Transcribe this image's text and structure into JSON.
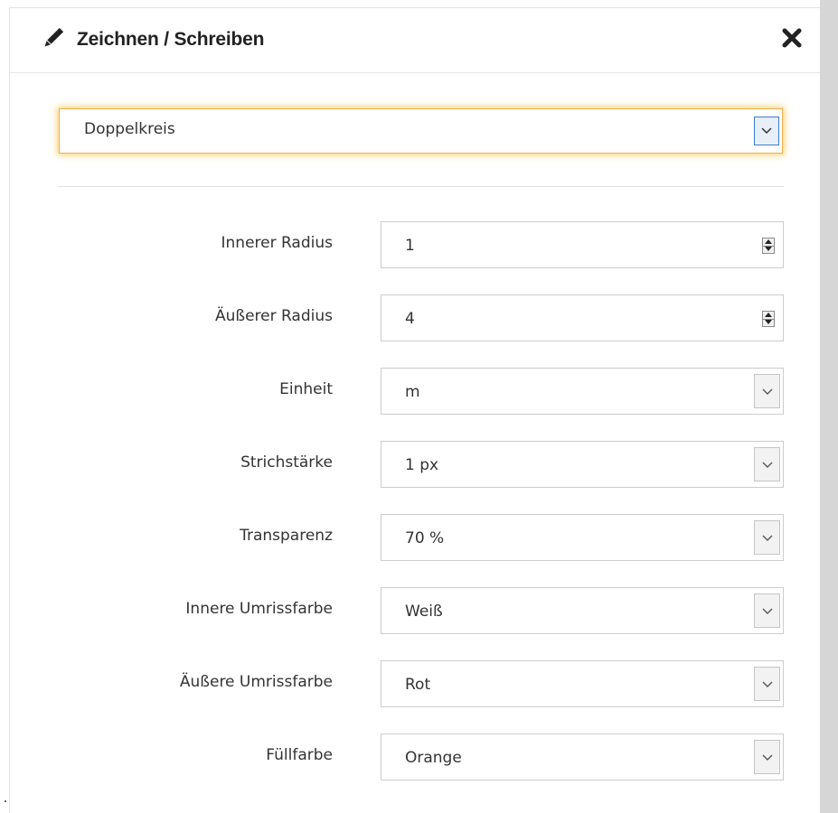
{
  "dialog": {
    "title": "Zeichnen / Schreiben",
    "title_icon": "pencil-icon",
    "close_icon": "close-icon",
    "shape_select": {
      "value": "Doppelkreis",
      "focused": true
    }
  },
  "form": {
    "inner_radius": {
      "label": "Innerer Radius",
      "value": "1",
      "control": "number"
    },
    "outer_radius": {
      "label": "Äußerer Radius",
      "value": "4",
      "control": "number"
    },
    "unit": {
      "label": "Einheit",
      "value": "m",
      "control": "select"
    },
    "stroke_width": {
      "label": "Strichstärke",
      "value": "1 px",
      "control": "select"
    },
    "transparency": {
      "label": "Transparenz",
      "value": "70 %",
      "control": "select"
    },
    "inner_outline_color": {
      "label": "Innere Umrissfarbe",
      "value": "Weiß",
      "control": "select"
    },
    "outer_outline_color": {
      "label": "Äußere Umrissfarbe",
      "value": "Rot",
      "control": "select"
    },
    "fill_color": {
      "label": "Füllfarbe",
      "value": "Orange",
      "control": "select"
    }
  },
  "colors": {
    "focus_border": "#f0ad4e",
    "focus_glow": "#f5c850",
    "caret_active_border": "#3a7bd5",
    "side_strip": "#d6d6d6"
  }
}
